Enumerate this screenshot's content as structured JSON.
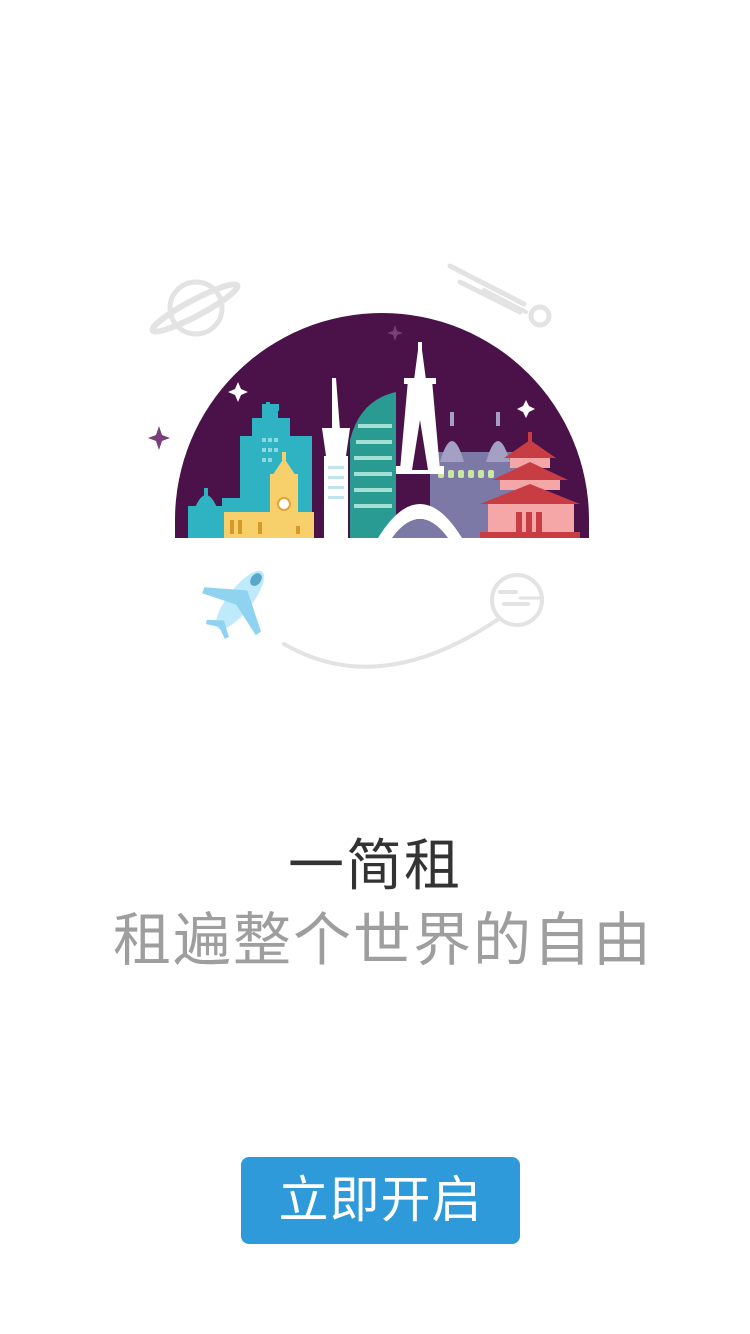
{
  "app": {
    "title": "一简租",
    "slogan": "租遍整个世界的自由"
  },
  "actions": {
    "start_label": "立即开启"
  },
  "colors": {
    "primary": "#2e9ad9",
    "title_text": "#333333",
    "slogan_text": "#9e9e9e",
    "dome_bg": "#4a1248"
  },
  "illustration": {
    "icons": [
      "planet-icon",
      "comet-icon",
      "sparkle-icon",
      "cityscape-illustration",
      "airplane-icon",
      "moon-icon"
    ]
  }
}
